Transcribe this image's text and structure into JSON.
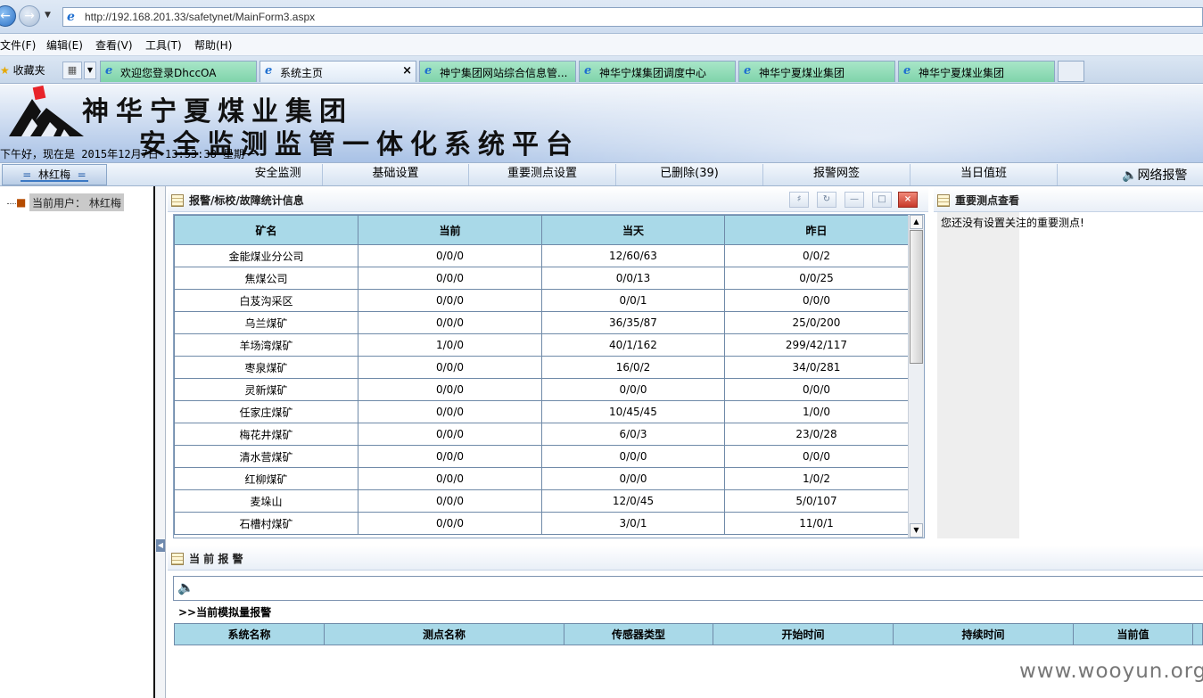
{
  "browser": {
    "url": "http://192.168.201.33/safetynet/MainForm3.aspx",
    "menu": [
      "文件(F)",
      "编辑(E)",
      "查看(V)",
      "工具(T)",
      "帮助(H)"
    ],
    "favorites_label": "收藏夹",
    "tabs": [
      {
        "label": "欢迎您登录DhccOA",
        "active": false
      },
      {
        "label": "系统主页",
        "active": true
      },
      {
        "label": "神宁集团网站综合信息管...",
        "active": false
      },
      {
        "label": "神华宁煤集团调度中心",
        "active": false
      },
      {
        "label": "神华宁夏煤业集团",
        "active": false
      },
      {
        "label": "神华宁夏煤业集团",
        "active": false
      }
    ]
  },
  "banner": {
    "title1": "神华宁夏煤业集团",
    "title2": "安全监测监管一体化系统平台",
    "greeting": "下午好，现在是 2015年12月7日 13:53:38 星期一"
  },
  "nav": {
    "user_tab": "林红梅",
    "items": [
      "安全监测",
      "基础设置",
      "重要测点设置",
      "已删除(39)",
      "报警网签",
      "当日值班",
      "网络报警"
    ]
  },
  "left": {
    "current_user_label": "当前用户：",
    "current_user": "林红梅"
  },
  "stats_panel": {
    "title": "报警/标校/故障统计信息",
    "columns": [
      "矿名",
      "当前",
      "当天",
      "昨日"
    ],
    "rows": [
      [
        "金能煤业分公司",
        "0/0/0",
        "12/60/63",
        "0/0/2"
      ],
      [
        "焦煤公司",
        "0/0/0",
        "0/0/13",
        "0/0/25"
      ],
      [
        "白芨沟采区",
        "0/0/0",
        "0/0/1",
        "0/0/0"
      ],
      [
        "乌兰煤矿",
        "0/0/0",
        "36/35/87",
        "25/0/200"
      ],
      [
        "羊场湾煤矿",
        "1/0/0",
        "40/1/162",
        "299/42/117"
      ],
      [
        "枣泉煤矿",
        "0/0/0",
        "16/0/2",
        "34/0/281"
      ],
      [
        "灵新煤矿",
        "0/0/0",
        "0/0/0",
        "0/0/0"
      ],
      [
        "任家庄煤矿",
        "0/0/0",
        "10/45/45",
        "1/0/0"
      ],
      [
        "梅花井煤矿",
        "0/0/0",
        "6/0/3",
        "23/0/28"
      ],
      [
        "清水营煤矿",
        "0/0/0",
        "0/0/0",
        "0/0/0"
      ],
      [
        "红柳煤矿",
        "0/0/0",
        "0/0/0",
        "1/0/2"
      ],
      [
        "麦垛山",
        "0/0/0",
        "12/0/45",
        "5/0/107"
      ],
      [
        "石槽村煤矿",
        "0/0/0",
        "3/0/1",
        "11/0/1"
      ]
    ]
  },
  "important_panel": {
    "title": "重要测点查看",
    "message": "您还没有设置关注的重要测点!"
  },
  "alarm_panel": {
    "title": "当 前 报 警",
    "analog_title": ">>当前模拟量报警",
    "columns": [
      "系统名称",
      "测点名称",
      "传感器类型",
      "开始时间",
      "持续时间",
      "当前值"
    ]
  },
  "watermark": "www.wooyun.org",
  "colors": {
    "table_header": "#a9d9e8",
    "tab_green": "#7fd3aa",
    "banner_blue": "#a9c2e6"
  }
}
